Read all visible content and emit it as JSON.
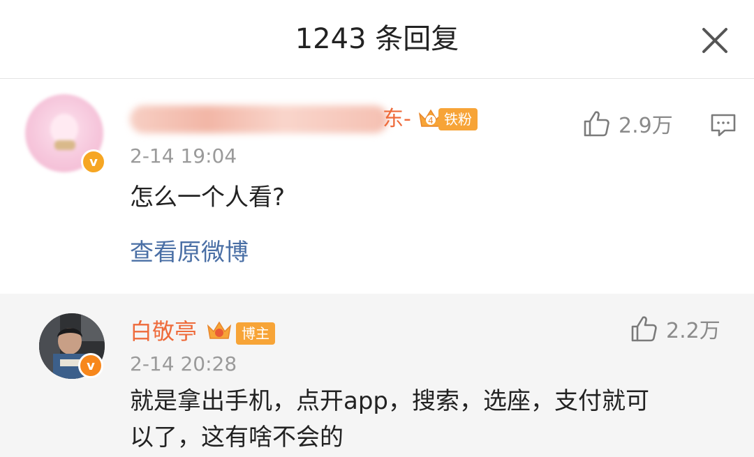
{
  "header": {
    "title": "1243 条回复"
  },
  "main_comment": {
    "username_suffix": "东-",
    "tag": "铁粉",
    "crown_level": "4",
    "time": "2-14 19:04",
    "text": "怎么一个人看?",
    "likes": "2.9万",
    "view_original": "查看原微博"
  },
  "reply_comment": {
    "username": "白敬亭",
    "tag": "博主",
    "time": "2-14 20:28",
    "text_line1": "就是拿出手机，点开app，搜索，选座，支付就可",
    "text_line2": "以了，这有啥不会的",
    "likes": "2.2万"
  },
  "colors": {
    "accent_orange": "#ee6b3b",
    "tag_orange": "#f7a437",
    "link_blue": "#4a6fa5",
    "verified_gold": "#f6a623"
  },
  "icons": {
    "close": "close-icon",
    "like": "thumbs-up-icon",
    "reply": "comment-bubble-icon",
    "crown": "crown-icon",
    "verified": "verified-v-icon"
  }
}
